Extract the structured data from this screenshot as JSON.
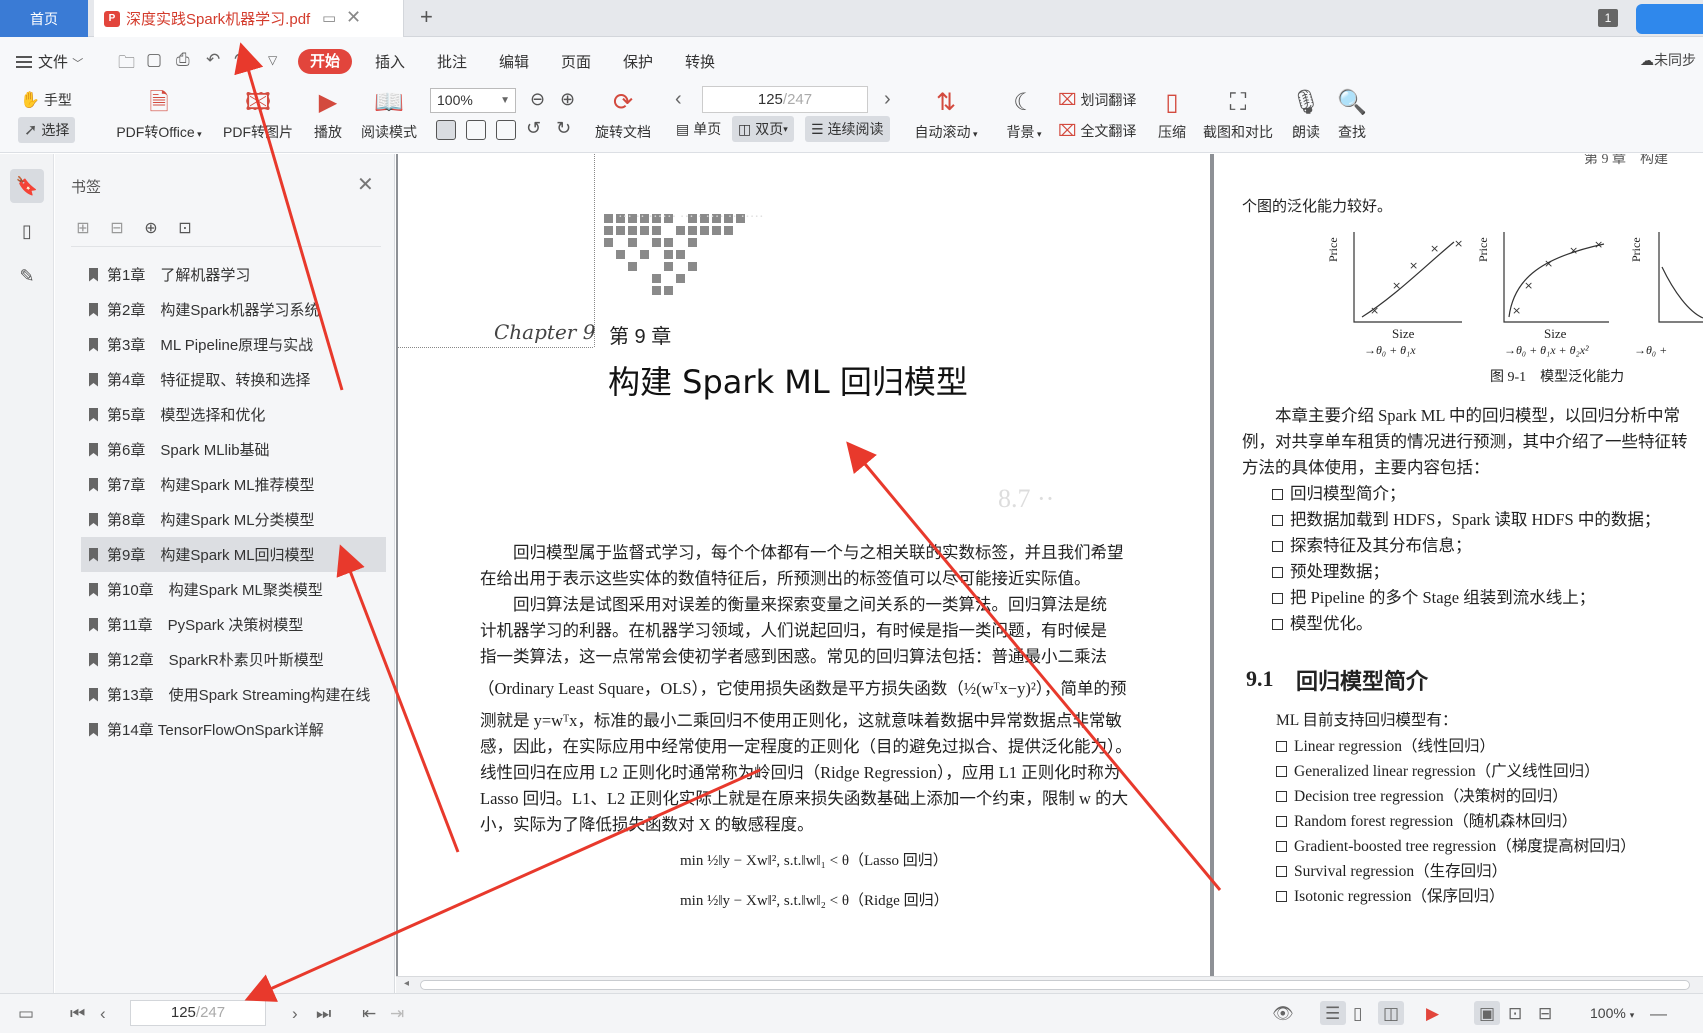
{
  "tabs": {
    "home": "首页",
    "document": "深度实践Spark机器学习.pdf",
    "window_count": "1"
  },
  "menu": {
    "file": "文件",
    "items": [
      "开始",
      "插入",
      "批注",
      "编辑",
      "页面",
      "保护",
      "转换"
    ],
    "cloud_sync": "未同步"
  },
  "toolbar": {
    "hand": "手型",
    "select": "选择",
    "pdf_to_office": "PDF转Office",
    "pdf_to_image": "PDF转图片",
    "play": "播放",
    "read_mode": "阅读模式",
    "zoom": "100%",
    "rotate": "旋转文档",
    "page_current": "125",
    "page_total": "/247",
    "single_page": "单页",
    "double_page": "双页",
    "continuous": "连续阅读",
    "auto_scroll": "自动滚动",
    "background": "背景",
    "word_translate": "划词翻译",
    "full_translate": "全文翻译",
    "compress": "压缩",
    "screenshot_compare": "截图和对比",
    "read_aloud": "朗读",
    "find": "查找"
  },
  "bookmarks": {
    "title": "书签",
    "items": [
      "第1章　了解机器学习",
      "第2章　构建Spark机器学习系统",
      "第3章　ML Pipeline原理与实战",
      "第4章　特征提取、转换和选择",
      "第5章　模型选择和优化",
      "第6章　Spark MLlib基础",
      "第7章　构建Spark ML推荐模型",
      "第8章　构建Spark ML分类模型",
      "第9章　构建Spark ML回归模型",
      "第10章　构建Spark ML聚类模型",
      "第11章　PySpark 决策树模型",
      "第12章　SparkR朴素贝叶斯模型",
      "第13章　使用Spark Streaming构建在线",
      "第14章 TensorFlowOnSpark详解"
    ],
    "selected_index": 8
  },
  "left_page": {
    "chapter_script": "Chapter 9",
    "chapter_num": "第 9 章",
    "chapter_title": "构建 Spark ML 回归模型",
    "lines": [
      "　　回归模型属于监督式学习，每个个体都有一个与之相关联的实数标签，并且我们希望",
      "在给出用于表示这些实体的数值特征后，所预测出的标签值可以尽可能接近实际值。",
      "　　回归算法是试图采用对误差的衡量来探索变量之间关系的一类算法。回归算法是统",
      "计机器学习的利器。在机器学习领域，人们说起回归，有时候是指一类问题，有时候是",
      "指一类算法，这一点常常会使初学者感到困惑。常见的回归算法包括：普通最小二乘法",
      "（Ordinary Least Square，OLS），它使用损失函数是平方损失函数（½(wᵀx−y)²），简单的预",
      "测就是 y=wᵀx，标准的最小二乘回归不使用正则化，这就意味着数据中异常数据点非常敏",
      "感，因此，在实际应用中经常使用一定程度的正则化（目的避免过拟合、提供泛化能力）。",
      "线性回归在应用 L2 正则化时通常称为岭回归（Ridge Regression），应用 L1 正则化时称为",
      "Lasso 回归。L1、L2 正则化实际上就是在原来损失函数基础上添加一个约束，限制 w 的大",
      "小，实际为了降低损失函数对 X 的敏感程度。"
    ],
    "formula_lasso": "min ½‖y − Xw‖², s.t.‖w‖₁ < θ（Lasso 回归）",
    "formula_ridge": "min ½‖y − Xw‖², s.t.‖w‖₂ < θ（Ridge 回归）"
  },
  "right_page": {
    "header": "第 9 章　构建",
    "top_line": "个图的泛化能力较好。",
    "figure": {
      "ylabel": "Price",
      "xlabel": "Size",
      "eq1": "→θ₀ + θ₁x",
      "eq2": "→θ₀ + θ₁x + θ₂x²",
      "eq3": "→θ₀ +",
      "caption": "图 9-1　模型泛化能力"
    },
    "intro": [
      "　　本章主要介绍 Spark ML 中的回归模型，以回归分析中常",
      "例，对共享单车租赁的情况进行预测，其中介绍了一些特征转",
      "方法的具体使用，主要内容包括："
    ],
    "bullets": [
      "回归模型简介；",
      "把数据加载到 HDFS，Spark 读取 HDFS 中的数据；",
      "探索特征及其分布信息；",
      "预处理数据；",
      "把 Pipeline 的多个 Stage 组装到流水线上；",
      "模型优化。"
    ],
    "section_num": "9.1",
    "section_title": "回归模型简介",
    "section_lead": "ML 目前支持回归模型有：",
    "models": [
      "Linear regression（线性回归）",
      "Generalized linear regression（广义线性回归）",
      "Decision tree regression（决策树的回归）",
      "Random forest regression（随机森林回归）",
      "Gradient-boosted tree regression（梯度提高树回归）",
      "Survival regression（生存回归）",
      "Isotonic regression（保序回归）"
    ]
  },
  "status": {
    "page_current": "125",
    "page_total": "/247",
    "zoom": "100%"
  },
  "colors": {
    "accent_red": "#e2453c",
    "tab_blue": "#3a7bd5",
    "annotation_arrow": "#e8392c"
  }
}
